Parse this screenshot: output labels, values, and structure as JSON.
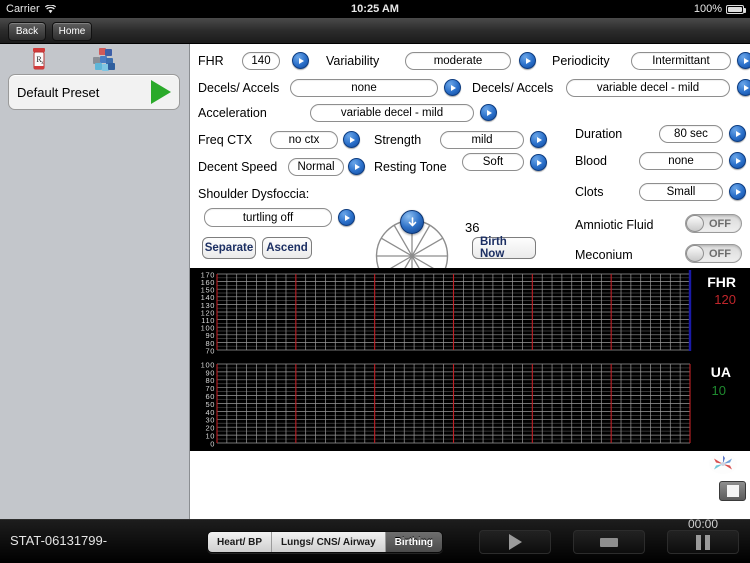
{
  "statusbar": {
    "carrier": "Carrier",
    "wifi_icon": "wifi-icon",
    "time": "10:25 AM",
    "battery_pct": "100%",
    "battery_icon": "battery-icon"
  },
  "navbar": {
    "back_label": "Back",
    "home_label": "Home"
  },
  "sidebar": {
    "icons": [
      {
        "name": "rx-bottle-icon"
      },
      {
        "name": "medical-blocks-icon"
      }
    ],
    "preset": {
      "label": "Default Preset",
      "play_icon": "play-triangle-icon"
    }
  },
  "panel": {
    "rows": [
      {
        "label": "FHR",
        "value": "140",
        "arrow": "disclosure-arrow-icon"
      },
      {
        "label": "Variability",
        "value": "moderate",
        "arrow": "disclosure-arrow-icon"
      },
      {
        "label": "Periodicity",
        "value": "Intermittant",
        "arrow": "disclosure-arrow-icon"
      },
      {
        "label": "Decels/ Accels",
        "value": "none",
        "arrow": "disclosure-arrow-icon"
      },
      {
        "label": "Decels/ Accels",
        "value": "variable decel - mild",
        "arrow": "disclosure-arrow-icon"
      },
      {
        "label": "Acceleration",
        "value": "variable decel - mild",
        "arrow": "disclosure-arrow-icon"
      },
      {
        "label": "Freq CTX",
        "value": "no ctx",
        "arrow": "disclosure-arrow-icon"
      },
      {
        "label": "Strength",
        "value": "mild",
        "arrow": "disclosure-arrow-icon"
      },
      {
        "label": "Duration",
        "value": "80 sec",
        "arrow": "disclosure-arrow-icon"
      },
      {
        "label": "Decent Speed",
        "value": "Normal",
        "arrow": "disclosure-arrow-icon"
      },
      {
        "label": "Resting Tone",
        "value": "Soft",
        "arrow": "disclosure-arrow-icon"
      },
      {
        "label": "Blood",
        "value": "none",
        "arrow": "disclosure-arrow-icon"
      },
      {
        "label": "Clots",
        "value": "Small",
        "arrow": "disclosure-arrow-icon"
      },
      {
        "label": "Shoulder Dysfoccia:",
        "value": "turtling off",
        "arrow": "disclosure-arrow-icon"
      }
    ],
    "toggles": [
      {
        "label": "Amniotic Fluid",
        "state": "OFF"
      },
      {
        "label": "Meconium",
        "state": "OFF"
      }
    ],
    "buttons": {
      "separate": "Separate",
      "ascend": "Ascend",
      "birth_now": "Birth Now"
    },
    "dial": {
      "value": "36",
      "knob_icon": "dial-knob-down-icon",
      "spokes": 12
    }
  },
  "chart_data": [
    {
      "type": "line",
      "title": "FHR",
      "series": [
        {
          "name": "FHR",
          "values": []
        }
      ],
      "current_value": "120",
      "value_color": "#c0262b",
      "label_color": "#ffffff",
      "ylabel": "FHR",
      "yticks": [
        170,
        160,
        150,
        140,
        130,
        120,
        110,
        100,
        90,
        80,
        70
      ],
      "ylim": [
        70,
        170
      ],
      "grid": true,
      "major_gridline_color": "#c12026",
      "minor_gridline_color": "#9a9a9a",
      "background": "#000000"
    },
    {
      "type": "line",
      "title": "UA",
      "series": [
        {
          "name": "UA",
          "values": []
        }
      ],
      "current_value": "10",
      "value_color": "#1f8a2f",
      "label_color": "#ffffff",
      "ylabel": "UA",
      "yticks": [
        100,
        90,
        80,
        70,
        60,
        50,
        40,
        30,
        20,
        10,
        0
      ],
      "ylim": [
        0,
        100
      ],
      "grid": true,
      "major_gridline_color": "#c12026",
      "minor_gridline_color": "#9a9a9a",
      "background": "#000000"
    }
  ],
  "overlay": {
    "pinwheel_icon": "pinwheel-icon",
    "switch_icon": "screen-toggle-icon"
  },
  "bottombar": {
    "case_id": "STAT-06131799-",
    "tabs": [
      {
        "label": "Heart/ BP",
        "selected": false
      },
      {
        "label": "Lungs/ CNS/ Airway",
        "selected": false
      },
      {
        "label": "Birthing",
        "selected": true
      }
    ],
    "transport": [
      {
        "name": "play-button",
        "icon": "play-icon"
      },
      {
        "name": "stop-button",
        "icon": "stop-icon"
      },
      {
        "name": "pause-button",
        "icon": "pause-icon"
      }
    ],
    "timer": "00:00"
  }
}
